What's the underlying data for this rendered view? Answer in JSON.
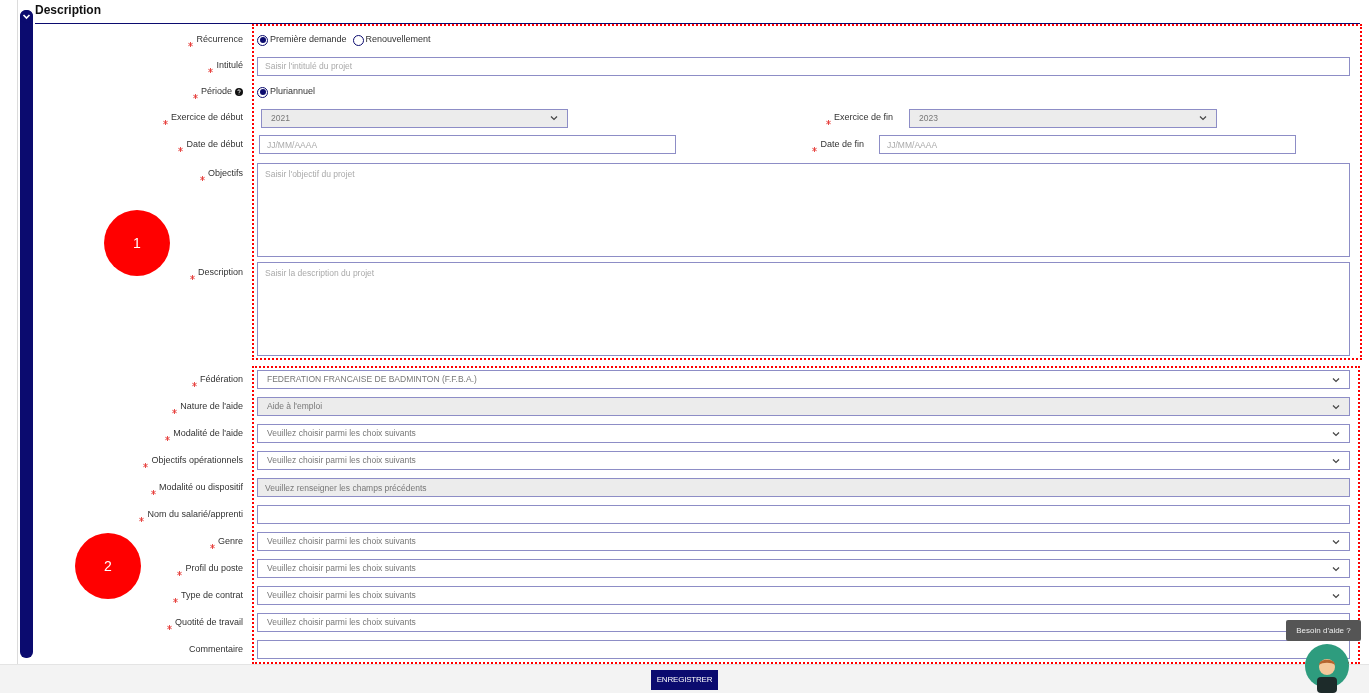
{
  "section": {
    "title": "Description",
    "expanded": true
  },
  "group1": {
    "marker": "1",
    "rows": [
      {
        "kind": "radio",
        "label": "Récurrence",
        "required": true,
        "options": [
          {
            "label": "Première demande",
            "selected": true
          },
          {
            "label": "Renouvellement",
            "selected": false
          }
        ]
      },
      {
        "kind": "text",
        "label": "Intitulé",
        "required": true,
        "placeholder": "Saisir l'intitulé du projet"
      },
      {
        "kind": "radio",
        "label": "Période",
        "required": true,
        "help": true,
        "options": [
          {
            "label": "Pluriannuel",
            "selected": true
          }
        ]
      },
      {
        "kind": "select-pair",
        "fields": [
          {
            "label": "Exercice de début",
            "required": true,
            "value": "2021",
            "disabled": true
          },
          {
            "label": "Exercice de fin",
            "required": true,
            "value": "2023",
            "disabled": true
          }
        ]
      },
      {
        "kind": "date-pair",
        "fields": [
          {
            "label": "Date de début",
            "required": true,
            "placeholder": "JJ/MM/AAAA"
          },
          {
            "label": "Date de fin",
            "required": true,
            "placeholder": "JJ/MM/AAAA"
          }
        ]
      },
      {
        "kind": "textarea",
        "label": "Objectifs",
        "required": true,
        "placeholder": "Saisir l'objectif du projet"
      },
      {
        "kind": "textarea",
        "label": "Description",
        "required": true,
        "placeholder": "Saisir la description du projet"
      }
    ]
  },
  "group2": {
    "marker": "2",
    "rows": [
      {
        "kind": "select",
        "label": "Fédération",
        "required": true,
        "value": "FEDERATION FRANCAISE DE BADMINTON (F.F.B.A.)",
        "disabled": false
      },
      {
        "kind": "select",
        "label": "Nature de l'aide",
        "required": true,
        "value": "Aide à l'emploi",
        "disabled": true
      },
      {
        "kind": "select",
        "label": "Modalité de l'aide",
        "required": true,
        "value": "Veuillez choisir parmi les choix suivants",
        "disabled": false
      },
      {
        "kind": "select",
        "label": "Objectifs opérationnels",
        "required": true,
        "value": "Veuillez choisir parmi les choix suivants",
        "disabled": false
      },
      {
        "kind": "text",
        "label": "Modalité ou dispositif",
        "required": true,
        "value": "Veuillez renseigner les champs précédents",
        "disabled": true
      },
      {
        "kind": "text",
        "label": "Nom du salarié/apprenti",
        "required": true,
        "disabled": false
      },
      {
        "kind": "select",
        "label": "Genre",
        "required": true,
        "value": "Veuillez choisir parmi les choix suivants",
        "disabled": false
      },
      {
        "kind": "select",
        "label": "Profil du poste",
        "required": true,
        "value": "Veuillez choisir parmi les choix suivants",
        "disabled": false
      },
      {
        "kind": "select",
        "label": "Type de contrat",
        "required": true,
        "value": "Veuillez choisir parmi les choix suivants",
        "disabled": false
      },
      {
        "kind": "select",
        "label": "Quotité de travail",
        "required": true,
        "value": "Veuillez choisir parmi les choix suivants",
        "disabled": false
      },
      {
        "kind": "text",
        "label": "Commentaire",
        "required": false,
        "disabled": false
      }
    ]
  },
  "save_button": "ENREGISTRER",
  "help_tooltip": "Besoin d'aide ?"
}
